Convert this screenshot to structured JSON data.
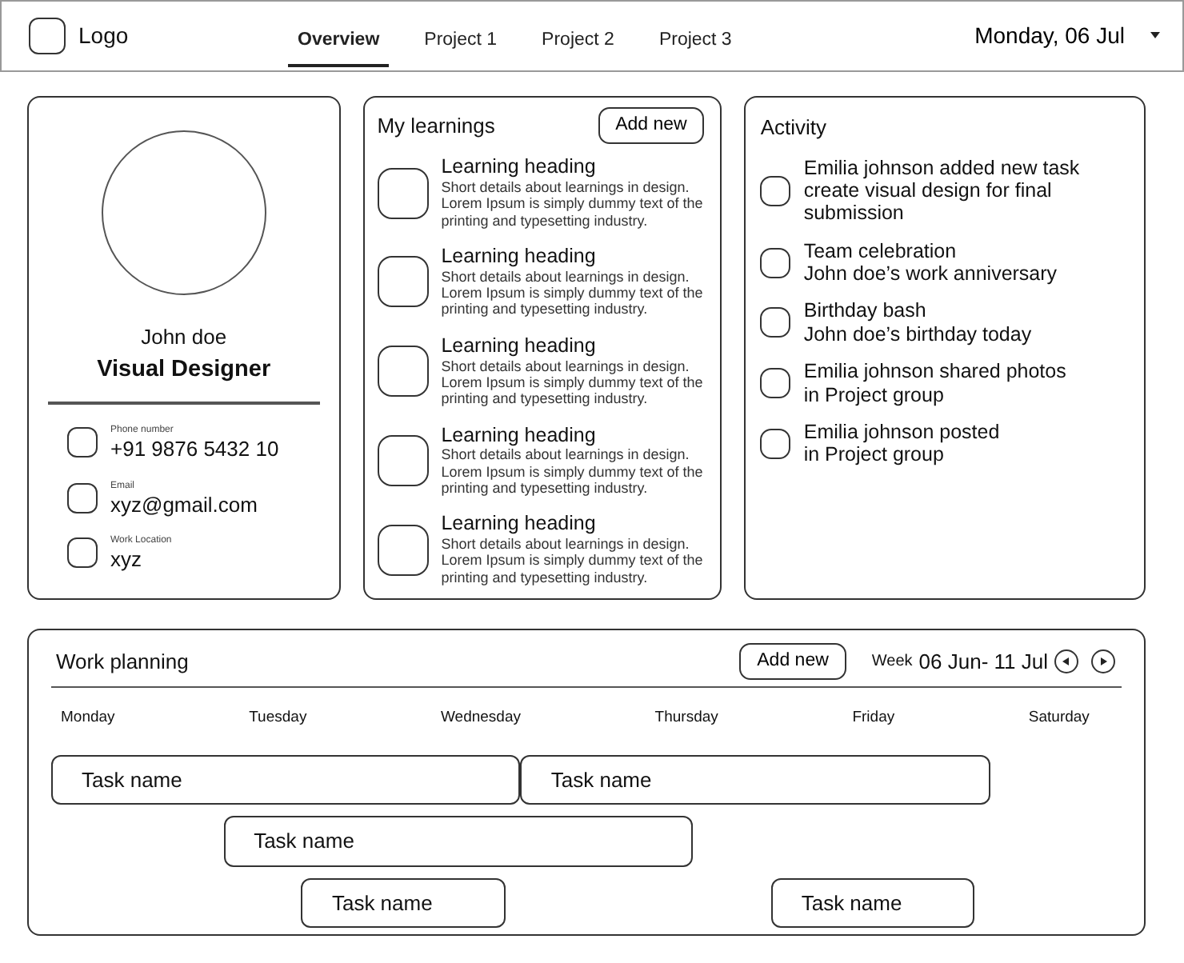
{
  "header": {
    "logo": "Logo",
    "tabs": [
      {
        "label": "Overview",
        "selected": true
      },
      {
        "label": "Project 1",
        "selected": false
      },
      {
        "label": "Project 2",
        "selected": false
      },
      {
        "label": "Project 3",
        "selected": false
      }
    ],
    "date": "Monday, 06 Jul"
  },
  "profile": {
    "name": "John doe",
    "role": "Visual Designer",
    "details": [
      {
        "label": "Phone number",
        "value": "+91 9876 5432 10"
      },
      {
        "label": "Email",
        "value": "xyz@gmail.com"
      },
      {
        "label": "Work Location",
        "value": "xyz"
      }
    ]
  },
  "learnings": {
    "title": "My learnings",
    "button": "Add new",
    "items": [
      {
        "heading": "Learning heading",
        "text": "Short details about learnings in design. Lorem Ipsum is simply dummy text of the printing and typesetting industry."
      },
      {
        "heading": "Learning heading",
        "text": "Short details about learnings in design. Lorem Ipsum is simply dummy text of the printing and typesetting industry."
      },
      {
        "heading": "Learning heading",
        "text": "Short details about learnings in design. Lorem Ipsum is simply dummy text of the printing and typesetting industry."
      },
      {
        "heading": "Learning heading",
        "text": "Short details about learnings in design. Lorem Ipsum is simply dummy text of the printing and typesetting industry."
      },
      {
        "heading": "Learning heading",
        "text": "Short details about learnings in design. Lorem Ipsum is simply dummy text of the printing and typesetting industry."
      }
    ]
  },
  "activity": {
    "title": "Activity",
    "items": [
      {
        "lines": [
          "Emilia johnson added new task",
          "create visual design for final",
          "submission"
        ]
      },
      {
        "lines": [
          "Team celebration",
          "John doe’s work anniversary"
        ]
      },
      {
        "lines": [
          "Birthday bash",
          "John doe’s birthday today"
        ]
      },
      {
        "lines": [
          "Emilia johnson shared photos",
          "in Project group"
        ]
      },
      {
        "lines": [
          "Emilia johnson posted",
          "in Project group"
        ]
      }
    ]
  },
  "planning": {
    "title": "Work planning",
    "button": "Add new",
    "week_label": "Week",
    "week": "06 Jun- 11 Jul",
    "days": [
      "Monday",
      "Tuesday",
      "Wednesday",
      "Thursday",
      "Friday",
      "Saturday"
    ],
    "tasks": [
      {
        "name": "Task name"
      },
      {
        "name": "Task name"
      },
      {
        "name": "Task name"
      },
      {
        "name": "Task name"
      },
      {
        "name": "Task name"
      }
    ]
  }
}
